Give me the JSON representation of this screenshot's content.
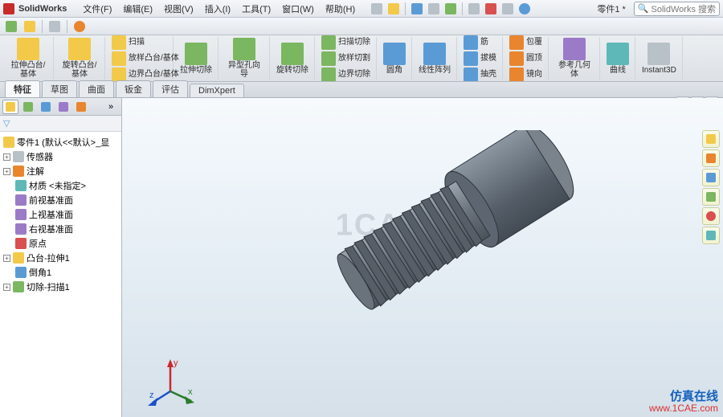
{
  "app": {
    "name": "SolidWorks"
  },
  "menus": {
    "file": "文件(F)",
    "edit": "编辑(E)",
    "view": "视图(V)",
    "insert": "插入(I)",
    "tools": "工具(T)",
    "window": "窗口(W)",
    "help": "帮助(H)"
  },
  "document": {
    "name": "零件1 *"
  },
  "search": {
    "placeholder": "SolidWorks 搜索"
  },
  "ribbon": {
    "extrude_boss": "拉伸凸台/基体",
    "revolve_boss": "旋转凸台/基体",
    "sweep": "扫描",
    "loft_boss": "放样凸台/基体",
    "boundary_boss": "边界凸台/基体",
    "extrude_cut": "拉伸切除",
    "hole_wizard": "异型孔向导",
    "revolve_cut": "旋转切除",
    "sweep_cut": "扫描切除",
    "loft_cut": "放样切割",
    "boundary_cut": "边界切除",
    "fillet": "圆角",
    "pattern": "线性阵列",
    "rib": "筋",
    "draft": "拔模",
    "shell": "抽壳",
    "wrap": "包覆",
    "dome": "圆顶",
    "mirror": "镜向",
    "ref_geom": "参考几何体",
    "curves": "曲线",
    "instant3d": "Instant3D"
  },
  "tabs": {
    "feature": "特征",
    "sketch": "草图",
    "surface": "曲面",
    "sheetmetal": "钣金",
    "evaluate": "评估",
    "dimxpert": "DimXpert"
  },
  "tree": {
    "root": "零件1 (默认<<默认>_显",
    "sensors": "传感器",
    "annotations": "注解",
    "material": "材质 <未指定>",
    "front_plane": "前视基准面",
    "top_plane": "上视基准面",
    "right_plane": "右视基准面",
    "origin": "原点",
    "feat1": "凸台-拉伸1",
    "feat2": "倒角1",
    "feat3": "切除-扫描1"
  },
  "triad": {
    "x": "x",
    "y": "y",
    "z": "z"
  },
  "watermark": "1CAE.COM",
  "branding": {
    "cn": "仿真在线",
    "url": "www.1CAE.com"
  }
}
